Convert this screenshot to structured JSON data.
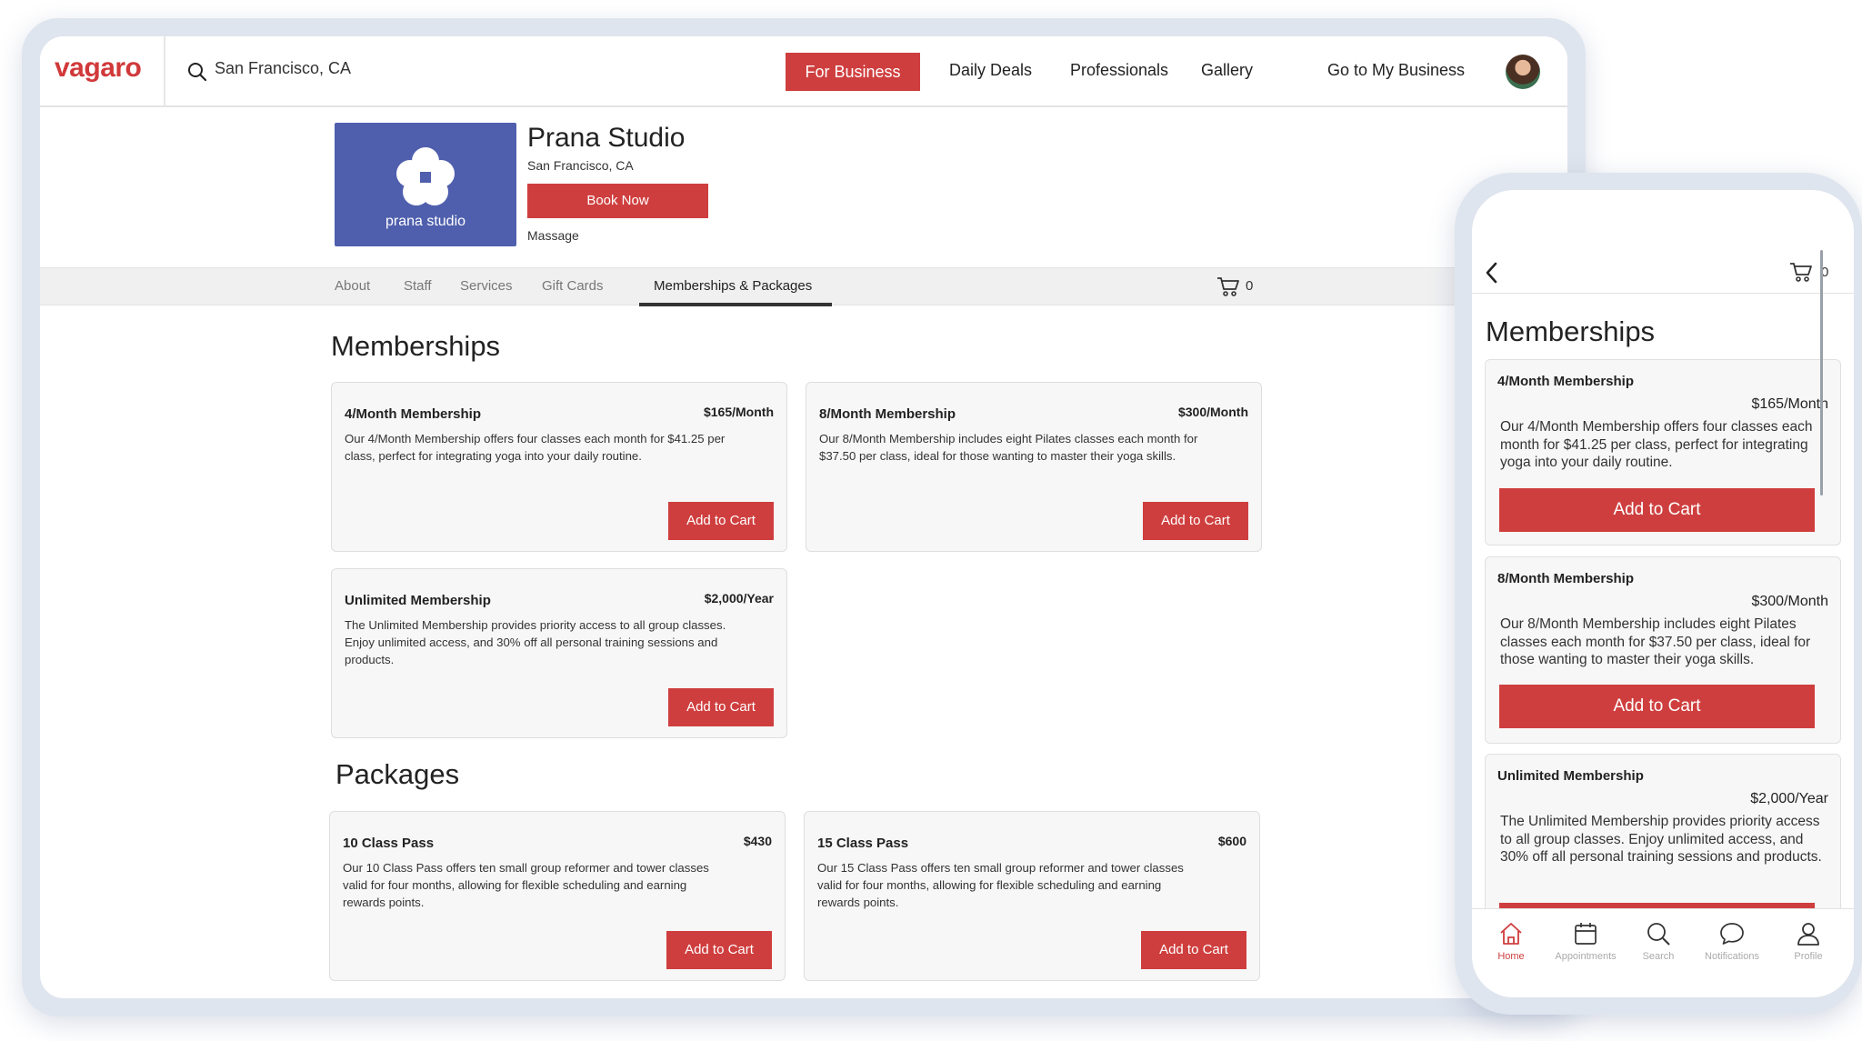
{
  "desktop": {
    "logo": "vagaro",
    "search": {
      "value": "San Francisco, CA"
    },
    "nav": {
      "for_business": "For Business",
      "daily_deals": "Daily Deals",
      "professionals": "Professionals",
      "gallery": "Gallery",
      "go_to_business": "Go to My Business"
    },
    "business": {
      "logo_text": "prana studio",
      "name": "Prana Studio",
      "location": "San Francisco, CA",
      "book_now": "Book Now",
      "category": "Massage"
    },
    "tabs": [
      {
        "label": "About"
      },
      {
        "label": "Staff"
      },
      {
        "label": "Services"
      },
      {
        "label": "Gift Cards"
      },
      {
        "label": "Memberships & Packages"
      }
    ],
    "cart_count": "0",
    "memberships_title": "Memberships",
    "packages_title": "Packages",
    "memberships": [
      {
        "name": "4/Month Membership",
        "price": "$165/Month",
        "desc": "Our 4/Month Membership offers four classes each month for $41.25 per class, perfect for integrating yoga into your daily routine.",
        "button": "Add to Cart"
      },
      {
        "name": "8/Month Membership",
        "price": "$300/Month",
        "desc": "Our 8/Month Membership includes eight Pilates classes each month for $37.50 per class, ideal for those wanting to master their yoga skills.",
        "button": "Add to Cart"
      },
      {
        "name": "Unlimited Membership",
        "price": "$2,000/Year",
        "desc": "The Unlimited Membership provides priority access to all group classes. Enjoy unlimited access, and 30% off all personal training sessions and products.",
        "button": "Add to Cart"
      }
    ],
    "packages": [
      {
        "name": "10 Class Pass",
        "price": "$430",
        "desc": "Our 10 Class Pass offers ten small group reformer and tower classes valid for four months, allowing for flexible scheduling and earning rewards points.",
        "button": "Add to Cart"
      },
      {
        "name": "15 Class Pass",
        "price": "$600",
        "desc": "Our 15 Class Pass offers ten small group reformer and tower classes valid for four months, allowing for flexible scheduling and earning rewards points.",
        "button": "Add to Cart"
      }
    ]
  },
  "mobile": {
    "cart_count": "0",
    "title": "Memberships",
    "memberships": [
      {
        "name": "4/Month Membership",
        "price": "$165/Month",
        "desc": "Our 4/Month Membership offers four classes each month for $41.25 per class, perfect for integrating yoga into your daily routine.",
        "button": "Add to Cart"
      },
      {
        "name": "8/Month Membership",
        "price": "$300/Month",
        "desc": "Our 8/Month Membership includes eight Pilates classes each month for $37.50 per class, ideal for those wanting to master their yoga skills.",
        "button": "Add to Cart"
      },
      {
        "name": "Unlimited Membership",
        "price": "$2,000/Year",
        "desc": "The Unlimited Membership provides priority access to all group classes. Enjoy unlimited access, and 30% off all personal training sessions and products."
      }
    ],
    "tabbar": [
      {
        "label": "Home",
        "icon": "home-icon"
      },
      {
        "label": "Appointments",
        "icon": "calendar-icon"
      },
      {
        "label": "Search",
        "icon": "search-icon"
      },
      {
        "label": "Notifications",
        "icon": "chat-bubble-icon"
      },
      {
        "label": "Profile",
        "icon": "person-icon"
      }
    ]
  },
  "colors": {
    "brand_red": "#cf3e3e",
    "logo_blue": "#4f5fad",
    "frame": "#dfe5ee"
  }
}
